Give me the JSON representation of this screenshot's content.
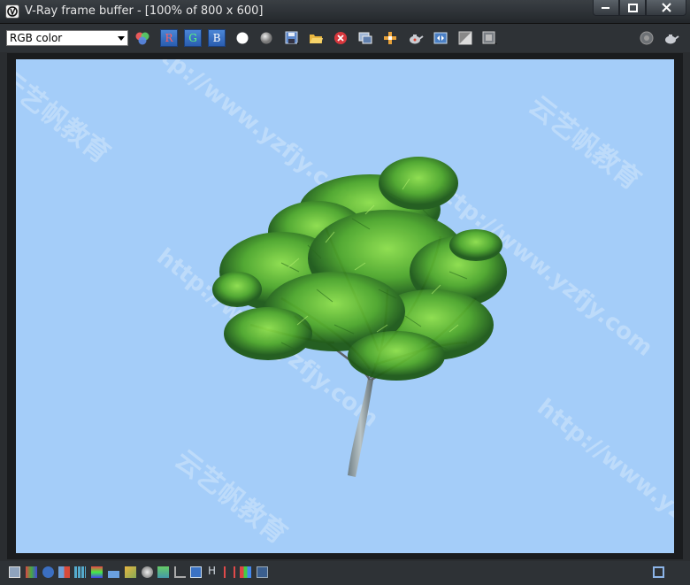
{
  "window": {
    "title": "V-Ray frame buffer - [100% of 800 x 600]",
    "buttons": [
      "minimize",
      "maximize",
      "close"
    ]
  },
  "toolbar": {
    "channel_select": {
      "value": "RGB color"
    },
    "channel_buttons": {
      "r": "R",
      "g": "G",
      "b": "B"
    },
    "icons": [
      "color-balls-icon",
      "red-channel",
      "green-channel",
      "blue-channel",
      "white-dot-icon",
      "gray-dot-icon",
      "save-icon",
      "open-folder-icon",
      "clear-icon",
      "duplicate-icon",
      "track-mouse-icon",
      "teapot-icon",
      "vfb-history-icon",
      "compare-icon",
      "stamp-icon",
      "lens-icon",
      "render-icon"
    ]
  },
  "render": {
    "background": "#a4cdf9",
    "subject": "tree",
    "watermarks": [
      "云艺帆教育",
      "http://www.yzfjy.com"
    ]
  },
  "statusbar": {
    "text_h": "H",
    "icons": [
      "panel-icon",
      "info-icon",
      "levels-icon",
      "stats-icon",
      "histogram-icon",
      "lut-icon",
      "gamma-icon",
      "compare-ab-icon",
      "histogram-small-icon",
      "curve-icon",
      "icc-icon",
      "h-icon",
      "bracket-icon",
      "exposure-icon",
      "target-icon",
      "window-icon"
    ]
  },
  "colors": {
    "titlebar": "#2b3034",
    "toolbar": "#2e3236",
    "channel_button": "#3a72c4",
    "sky": "#a4cdf9"
  }
}
